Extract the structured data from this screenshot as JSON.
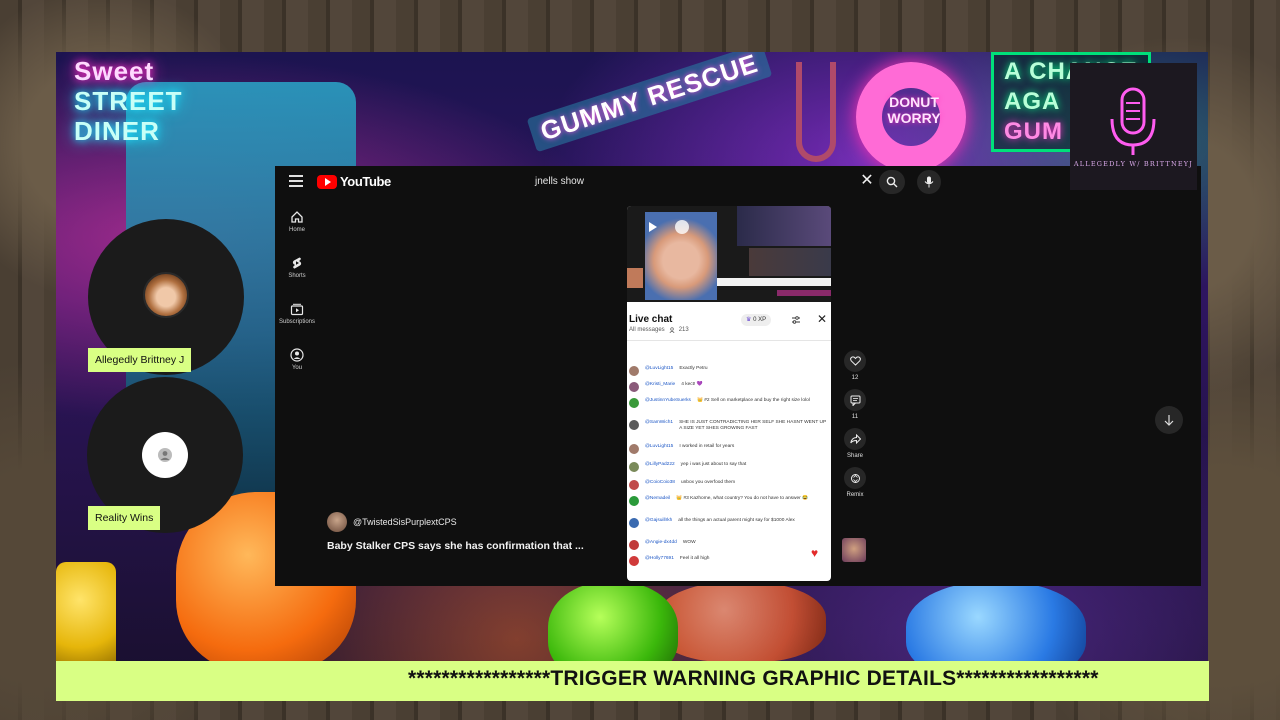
{
  "youtube": {
    "logo_text": "YouTube",
    "search_query": "jnells show",
    "nav": [
      {
        "label": "Home",
        "icon": "home-icon"
      },
      {
        "label": "Shorts",
        "icon": "shorts-icon"
      },
      {
        "label": "Subscriptions",
        "icon": "subscriptions-icon"
      },
      {
        "label": "You",
        "icon": "user-icon"
      }
    ],
    "short": {
      "channel": "@TwistedSisPurplextCPS",
      "caption": "Baby Stalker CPS says she has confirmation that ..."
    },
    "live_chat": {
      "title": "Live chat",
      "subtitle": "All messages",
      "viewers": "213",
      "xp_label": "0 XP",
      "messages": [
        {
          "author": "@LuvLight15",
          "text": "Exactly Petru",
          "avatar_color": "#a07a6a"
        },
        {
          "author": "@Kristi_Marie",
          "text": "4  kect! 💜",
          "avatar_color": "#8a5a7a"
        },
        {
          "author": "@JustinnYubeSuerks",
          "text": "👑 #2   Sell on marketplace and buy the right size lolol",
          "avatar_color": "#3a9a3a"
        },
        {
          "author": "@SamWich1",
          "text": "SHE IS JUST CONTRADICTING HER SELF SHE HASNT WENT UP A SIZE YET SHES GROWING FAST",
          "avatar_color": "#5a5a5a"
        },
        {
          "author": "@LuvLight15",
          "text": "I worked in retail for years",
          "avatar_color": "#a07a6a"
        },
        {
          "author": "@LillyPad222",
          "text": "yep i was just about to say that",
          "avatar_color": "#7a8a5a"
        },
        {
          "author": "@CoioCoio38",
          "text": "unbox you overfood them",
          "avatar_color": "#c04a4a"
        },
        {
          "author": "@Nemadeil",
          "text": "👑 #3   Kazhome, what country? You do not have to answer 😂",
          "avatar_color": "#2a9a3a"
        },
        {
          "author": "@Gajsuillrkh",
          "text": "all the things an actual parent might say for $1000 Alex",
          "avatar_color": "#3a6ab0"
        },
        {
          "author": "@Angie-dx4dd",
          "text": "WOW",
          "avatar_color": "#c03a3a"
        },
        {
          "author": "@Holly77691",
          "text": "Feel it all high",
          "avatar_color": "#d03a3a"
        }
      ]
    },
    "actions": {
      "like_count": "12",
      "comment_count": "11",
      "share_label": "Share",
      "remix_label": "Remix"
    }
  },
  "overlay": {
    "podcast_caption": "ALLEGEDLY W/ BRITTNEYJ",
    "participants": [
      {
        "name": "Allegedly Brittney J"
      },
      {
        "name": "Reality Wins"
      }
    ],
    "ticker": "*****************TRIGGER WARNING GRAPHIC DETAILS*****************"
  },
  "background": {
    "sign_diner_line1": "Sweet",
    "sign_diner_line2": "STREET",
    "sign_diner_line3": "DINER",
    "sign_gummy": "GUMMY RESCUE",
    "sign_donut": "DONUT WORRY",
    "sign_chance_line1": "A CHANCE",
    "sign_chance_line2": "AGA",
    "sign_chance_line3": "GUM"
  },
  "colors": {
    "accent_tag": "#d9ff84",
    "youtube_red": "#ff0000",
    "yt_bg": "#0f0f0f"
  }
}
